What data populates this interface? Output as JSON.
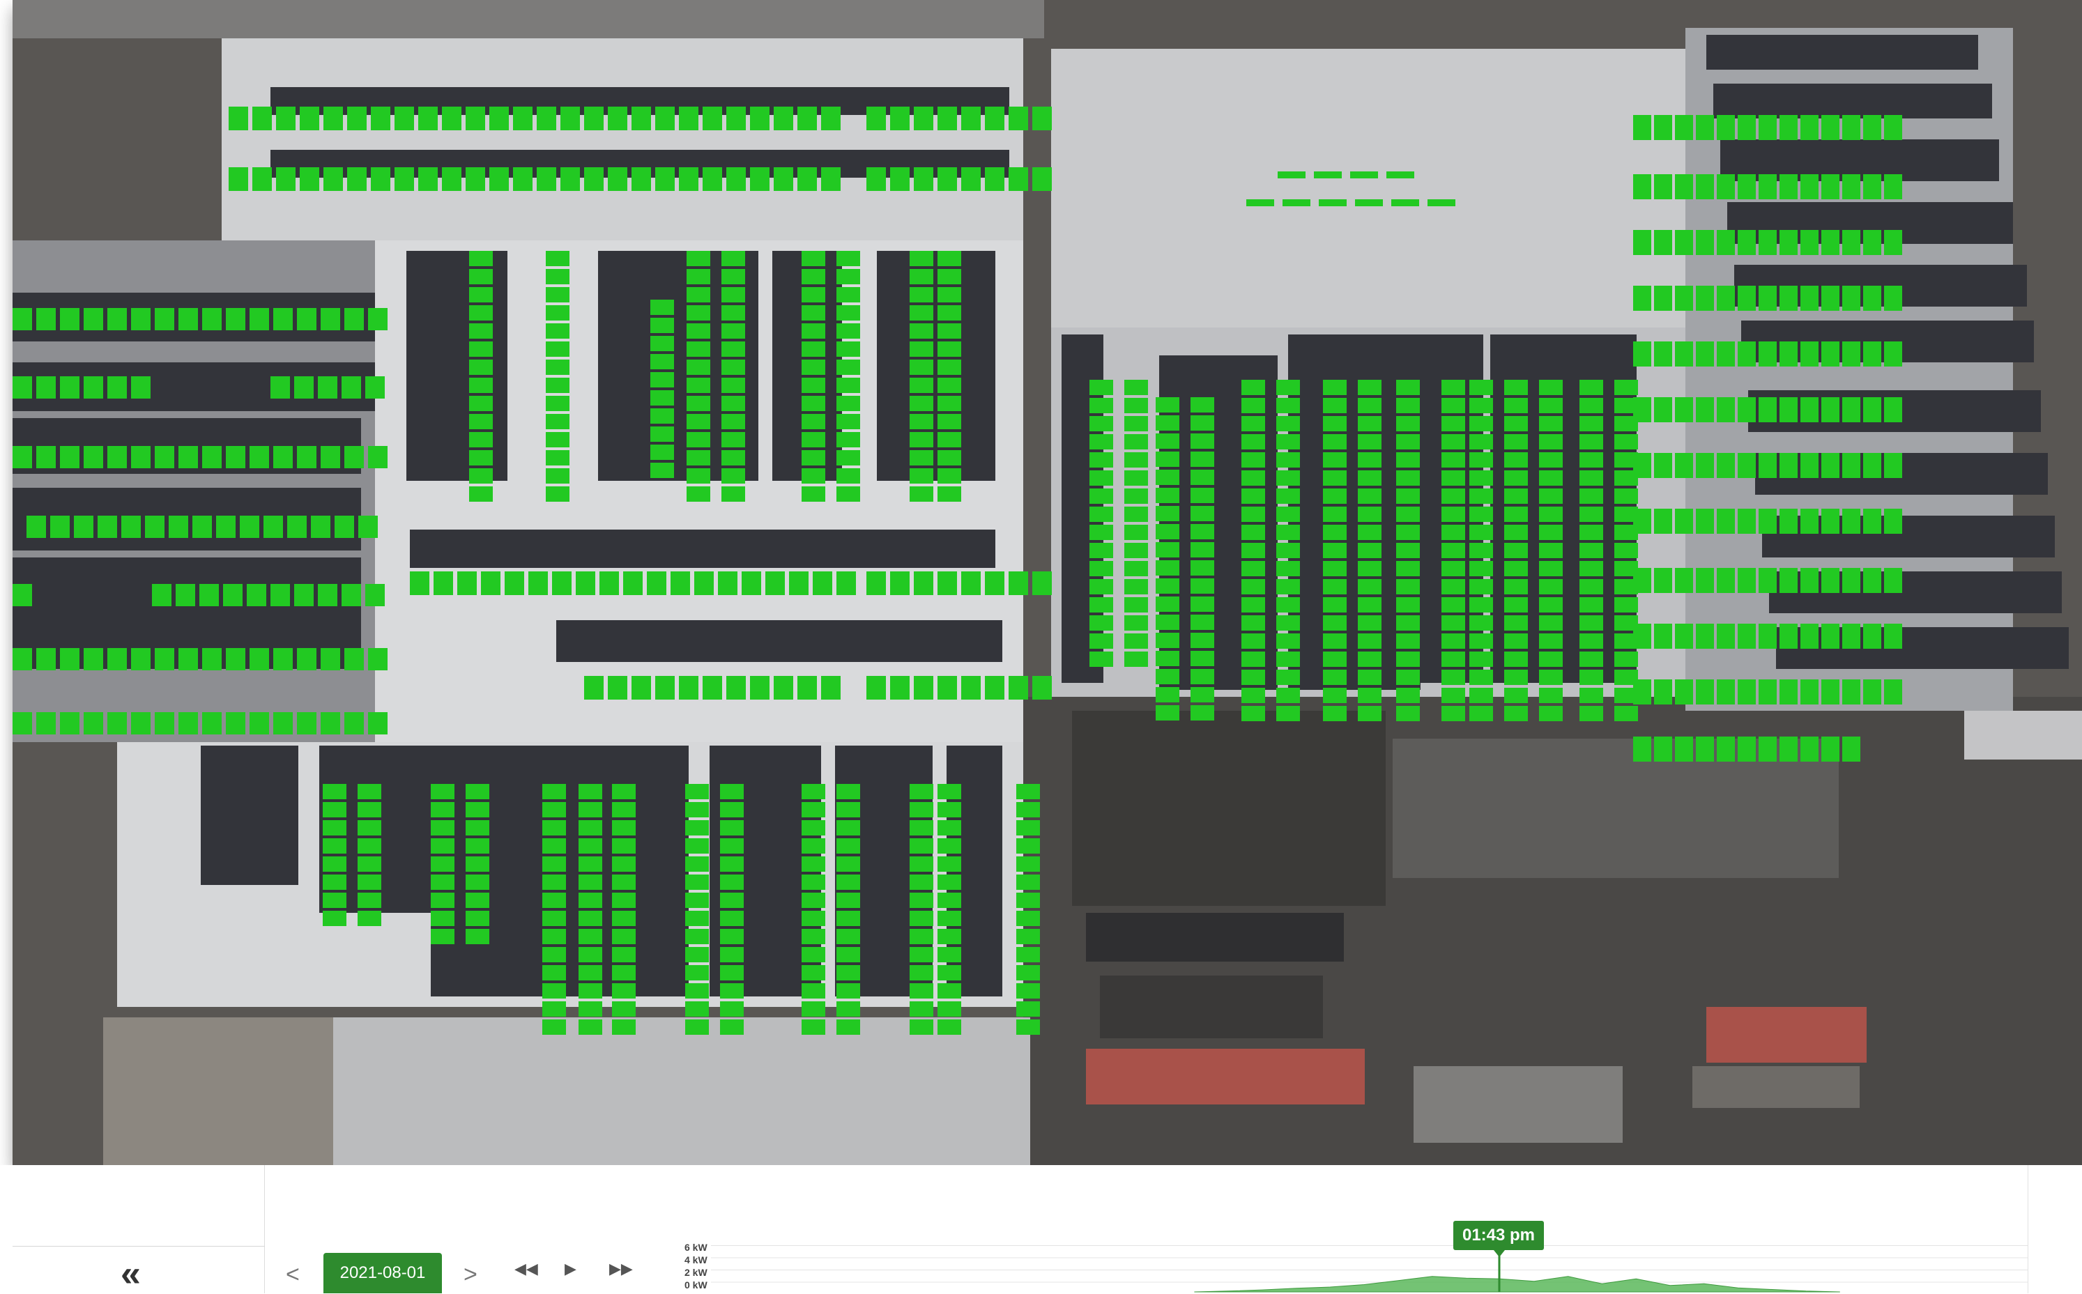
{
  "colors": {
    "accent": "#2e8b2e",
    "panel_overlay": "#22c922"
  },
  "photo": {
    "subject": "drone-roof-view",
    "overlay": "panel-status-markers"
  },
  "controls": {
    "collapse_label": "«",
    "prev_label": "<",
    "next_label": ">",
    "date": "2021-08-01",
    "rewind_icon": "rewind-icon",
    "play_icon": "play-icon",
    "ffwd_icon": "fast-forward-icon"
  },
  "chart": {
    "y_labels": [
      "6 kW",
      "4 kW",
      "2 kW",
      "0 kW"
    ],
    "current_time": "01:43 pm"
  },
  "chart_data": {
    "type": "area",
    "ylim": [
      0,
      6
    ],
    "y_unit": "kW",
    "y_ticks": [
      "6 kW",
      "4 kW",
      "2 kW",
      "0 kW"
    ],
    "x_start_fraction": 0.38,
    "x_end_fraction": 0.86,
    "values": [
      0,
      0.1,
      0.25,
      0.45,
      0.6,
      0.9,
      1.4,
      1.9,
      1.7,
      1.6,
      1.3,
      1.9,
      1.0,
      1.6,
      0.8,
      1.0,
      0.5,
      0.3,
      0.1,
      0
    ],
    "marker_time": "01:43 pm"
  }
}
